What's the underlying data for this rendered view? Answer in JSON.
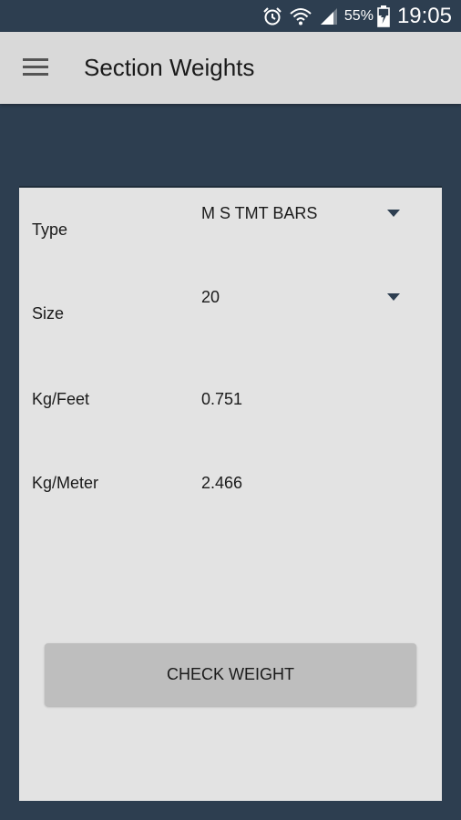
{
  "status_bar": {
    "battery_percent": "55%",
    "time": "19:05",
    "icons": [
      "alarm-icon",
      "wifi-icon",
      "signal-icon",
      "battery-charging-icon"
    ]
  },
  "app_bar": {
    "title": "Section Weights",
    "menu_icon": "menu-icon"
  },
  "form": {
    "type": {
      "label": "Type",
      "selected": "M S TMT BARS"
    },
    "size": {
      "label": "Size",
      "selected": "20"
    },
    "kg_feet": {
      "label": "Kg/Feet",
      "value": "0.751"
    },
    "kg_meter": {
      "label": "Kg/Meter",
      "value": "2.466"
    }
  },
  "actions": {
    "check_weight_label": "CHECK WEIGHT"
  },
  "colors": {
    "background": "#2d3e50",
    "app_bar": "#d9d9d9",
    "card": "#e3e3e3",
    "button": "#bebebe",
    "text": "#1a1a1a"
  }
}
